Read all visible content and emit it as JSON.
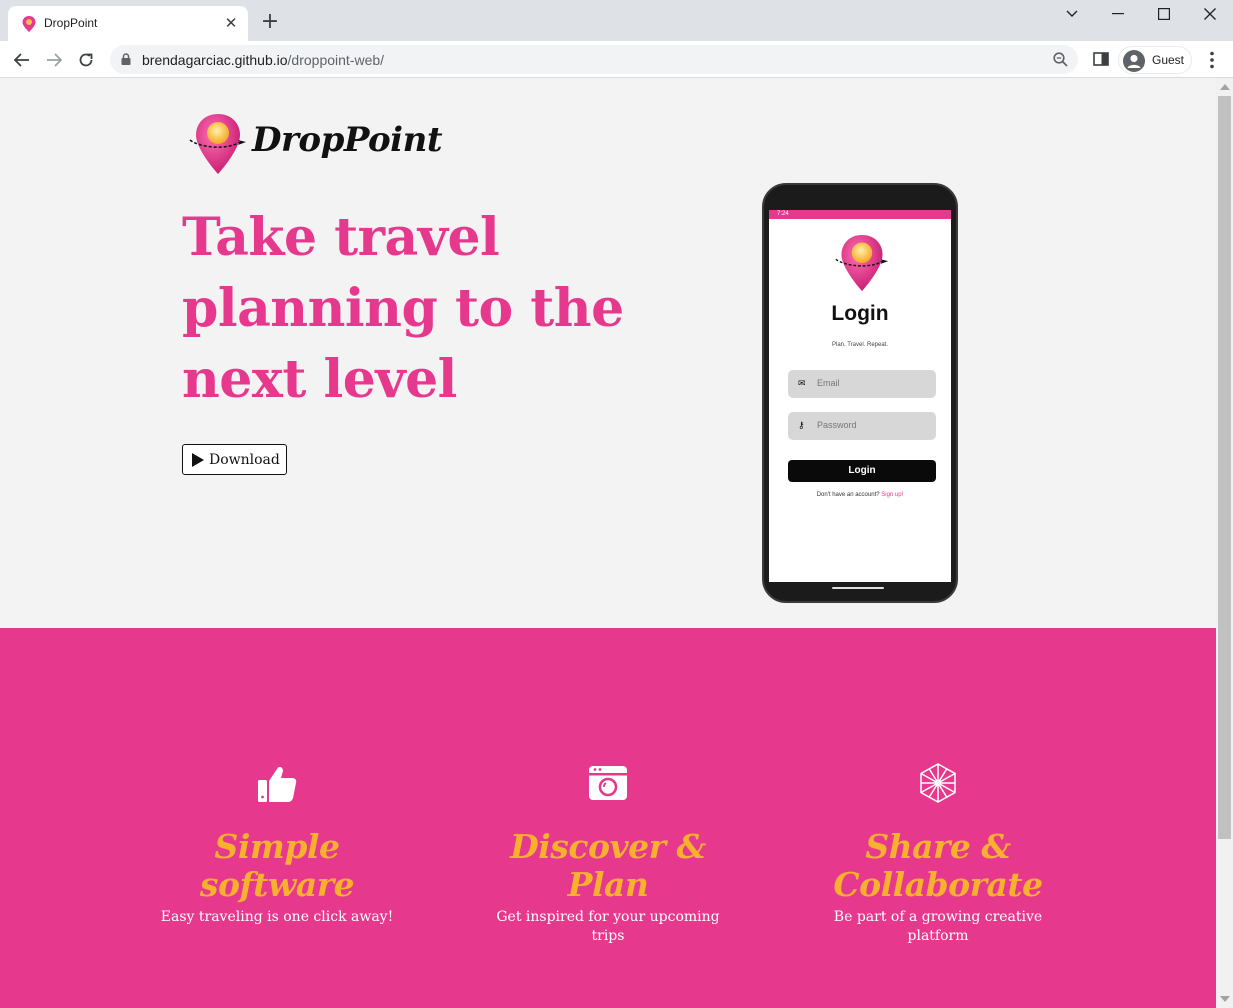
{
  "browser": {
    "tab_title": "DropPoint",
    "url_host": "brendagarciac.github.io",
    "url_path": "/droppoint-web/",
    "profile_label": "Guest"
  },
  "hero": {
    "logo_text": "DropPoint",
    "headline_lines": [
      "Take travel",
      "planning to the",
      "next level"
    ],
    "download_label": "Download"
  },
  "phone": {
    "status_time": "7:24",
    "title": "Login",
    "tagline": "Plan. Travel. Repeat.",
    "email_placeholder": "Email",
    "password_placeholder": "Password",
    "login_label": "Login",
    "signup_prompt": "Don't have an account?",
    "signup_link": "Sign up!"
  },
  "features": [
    {
      "icon": "thumbs-up-icon",
      "title": "Simple software",
      "description": "Easy traveling is one click away!"
    },
    {
      "icon": "camera-icon",
      "title": "Discover & Plan",
      "description": "Get inspired for your upcoming trips"
    },
    {
      "icon": "polyhedron-icon",
      "title": "Share & Collaborate",
      "description": "Be part of a growing creative platform"
    }
  ],
  "colors": {
    "brand_pink": "#e6398e",
    "accent_yellow": "#f8b02f",
    "hero_bg": "#f3f3f3"
  }
}
